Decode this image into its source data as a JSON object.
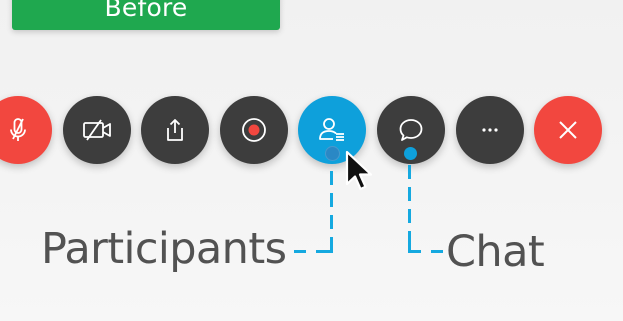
{
  "badge": {
    "label": "Before",
    "color": "#1fa84f"
  },
  "toolbar": {
    "buttons": [
      {
        "name": "mute-microphone",
        "icon": "microphone-muted-icon",
        "color": "#f2473f"
      },
      {
        "name": "stop-video",
        "icon": "video-off-icon",
        "color": "#3d3d3d"
      },
      {
        "name": "share-content",
        "icon": "share-icon",
        "color": "#3d3d3d"
      },
      {
        "name": "record",
        "icon": "record-icon",
        "color": "#3d3d3d"
      },
      {
        "name": "participants",
        "icon": "participants-icon",
        "color": "#0ea0db",
        "active": true
      },
      {
        "name": "chat",
        "icon": "chat-bubble-icon",
        "color": "#3d3d3d"
      },
      {
        "name": "more-options",
        "icon": "more-icon",
        "color": "#3d3d3d"
      },
      {
        "name": "leave-meeting",
        "icon": "close-icon",
        "color": "#f2473f"
      }
    ]
  },
  "annotations": {
    "participants_label": "Participants",
    "chat_label": "Chat",
    "leader_color": "#15a9e0"
  }
}
